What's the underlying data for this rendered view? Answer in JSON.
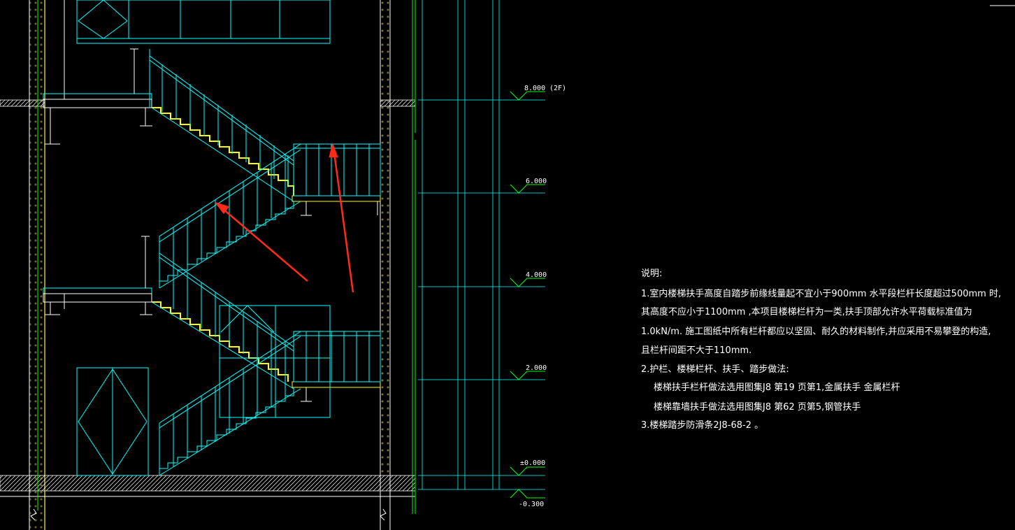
{
  "colors": {
    "background": "#000000",
    "cyan": "#00ffff",
    "yellow": "#ffff00",
    "green": "#00ff00",
    "white": "#ffffff",
    "arrow": "#ff2a1a"
  },
  "elevations": [
    {
      "value": "8.000",
      "suffix": "(2F)"
    },
    {
      "value": "6.000",
      "suffix": ""
    },
    {
      "value": "4.000",
      "suffix": ""
    },
    {
      "value": "2.000",
      "suffix": ""
    },
    {
      "value": "±0.000",
      "suffix": ""
    },
    {
      "value": "-0.300",
      "suffix": ""
    }
  ],
  "notes": {
    "title": "说明:",
    "line1": "1.室内楼梯扶手高度自踏步前缘线量起不宜小于900mm   水平段栏杆长度超过500mm   时,",
    "line2": "其高度不应小于1100mm   ,本项目楼梯栏杆为一类,扶手顶部允许水平荷载标准值为",
    "line3": "1.0kN/m.    施工图纸中所有栏杆都应以坚固、耐久的材料制作,并应采用不易攀登的构造,",
    "line4": "且栏杆间距不大于110mm.",
    "line5": "2.护栏、楼梯栏杆、扶手、踏步做法:",
    "line6": "楼梯扶手栏杆做法选用图集J8   第19 页第1,金属扶手 金属栏杆",
    "line7": "楼梯靠墙扶手做法选用图集J8   第62 页第5,钢管扶手",
    "line8": "3.楼梯踏步防滑条2J8-68-2      。"
  }
}
